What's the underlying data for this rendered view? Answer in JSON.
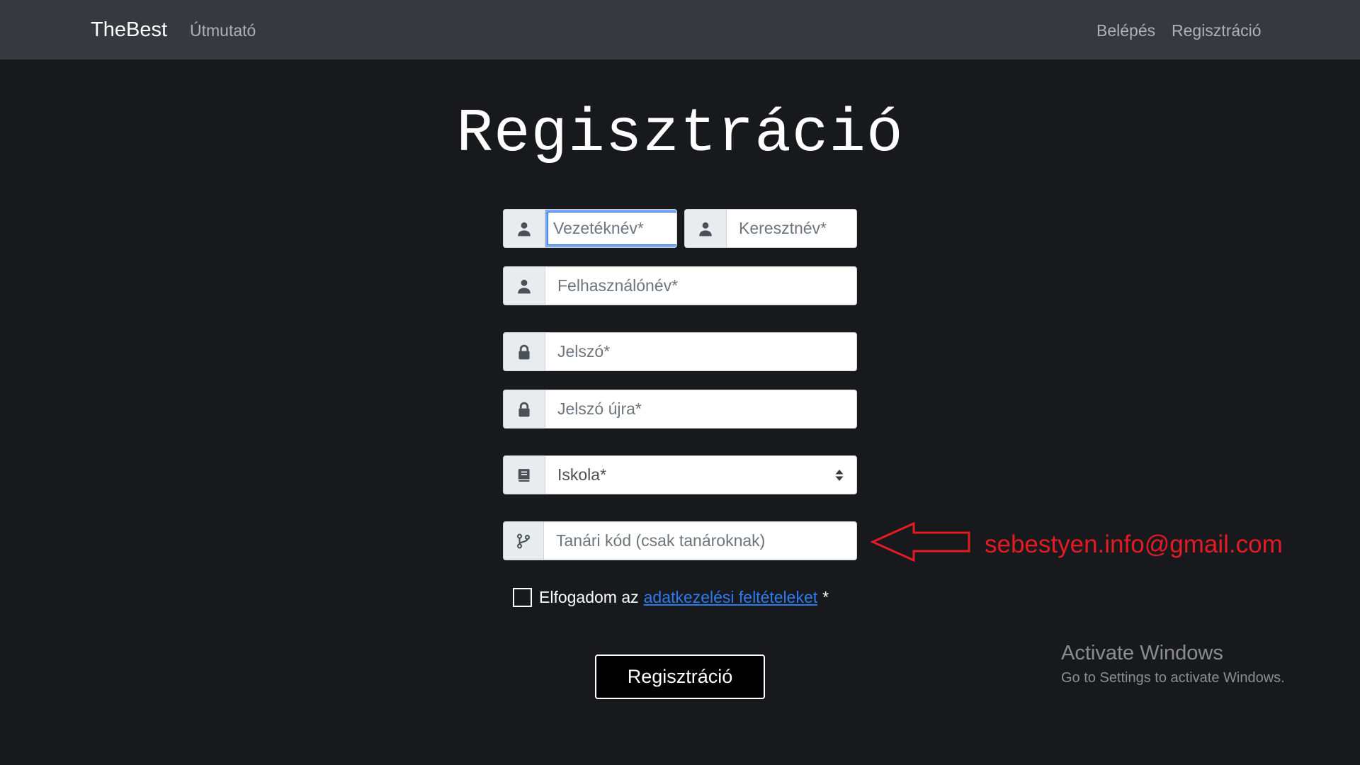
{
  "navbar": {
    "brand": "TheBest",
    "guide_link": "Útmutató",
    "login_link": "Belépés",
    "register_link": "Regisztráció"
  },
  "page_title": "Regisztráció",
  "form": {
    "last_name_placeholder": "Vezetéknév*",
    "first_name_placeholder": "Keresztnév*",
    "username_placeholder": "Felhasználónév*",
    "password_placeholder": "Jelszó*",
    "password_again_placeholder": "Jelszó újra*",
    "school_selected": "Iskola*",
    "teacher_code_placeholder": "Tanári kód (csak tanároknak)",
    "consent_prefix": "Elfogadom az",
    "consent_link": "adatkezelési feltételeket",
    "consent_suffix": "*",
    "submit_label": "Regisztráció"
  },
  "annotation": {
    "email": "sebestyen.info@gmail.com",
    "color": "#e41b23"
  },
  "watermark": {
    "title": "Activate Windows",
    "subtitle": "Go to Settings to activate Windows."
  },
  "icons": {
    "name_fields": "user-icon",
    "password_fields": "lock-icon",
    "school_field": "book-icon",
    "teacher_code_field": "branch-icon"
  }
}
